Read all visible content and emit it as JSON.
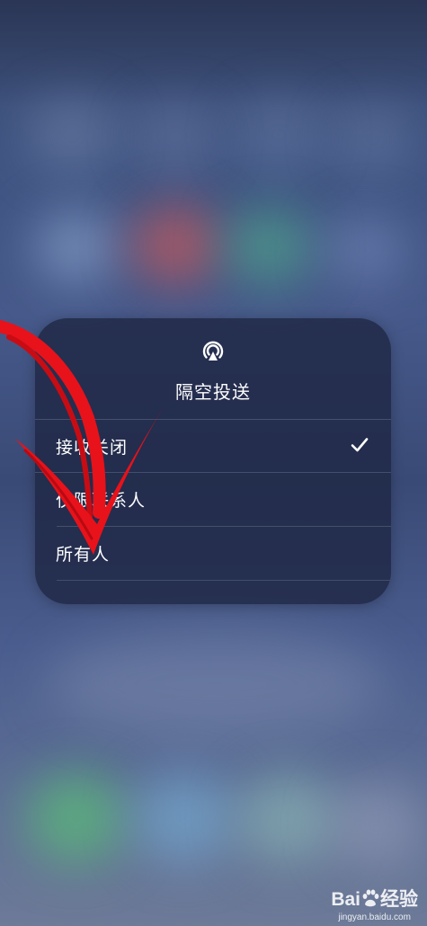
{
  "airdrop": {
    "icon": "airdrop-icon",
    "title": "隔空投送",
    "options": [
      {
        "label": "接收关闭",
        "selected": true
      },
      {
        "label": "仅限联系人",
        "selected": false
      },
      {
        "label": "所有人",
        "selected": false
      }
    ],
    "check_icon": "checkmark-icon"
  },
  "annotation": {
    "shape": "red-arrow",
    "color": "#e8121b"
  },
  "watermark": {
    "brand_prefix": "Bai",
    "brand_suffix": "经验",
    "url": "jingyan.baidu.com"
  }
}
